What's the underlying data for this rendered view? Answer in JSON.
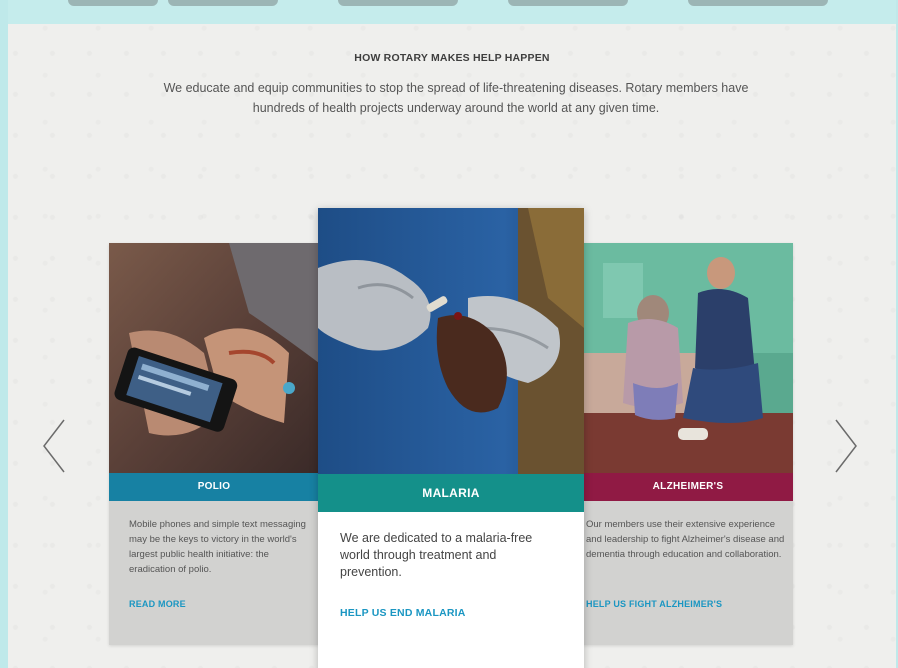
{
  "section": {
    "title": "HOW ROTARY MAKES HELP HAPPEN",
    "intro": "We educate and equip communities to stop the spread of life-threatening diseases. Rotary members have hundreds of health projects underway around the world at any given time."
  },
  "carousel": {
    "prev_icon": "chevron-left-icon",
    "next_icon": "chevron-right-icon",
    "cards": [
      {
        "key": "polio",
        "title": "POLIO",
        "description": "Mobile phones and simple text messaging may be the keys to victory in the world's largest public health initiative: the eradication of polio.",
        "link": "READ MORE",
        "color": "#1781a3"
      },
      {
        "key": "malaria",
        "title": "MALARIA",
        "description": "We are dedicated to a malaria-free world through treatment and prevention.",
        "link": "HELP US END MALARIA",
        "color": "#14908a"
      },
      {
        "key": "alzheimers",
        "title": "ALZHEIMER'S",
        "description": "Our members use their extensive experience and leadership to fight Alzheimer's disease and dementia through education and collaboration.",
        "link": "HELP US FIGHT ALZHEIMER'S",
        "color": "#901a44"
      }
    ]
  },
  "colors": {
    "background": "#efefed",
    "frame": "#bfe9ea",
    "link": "#1a96c2"
  }
}
